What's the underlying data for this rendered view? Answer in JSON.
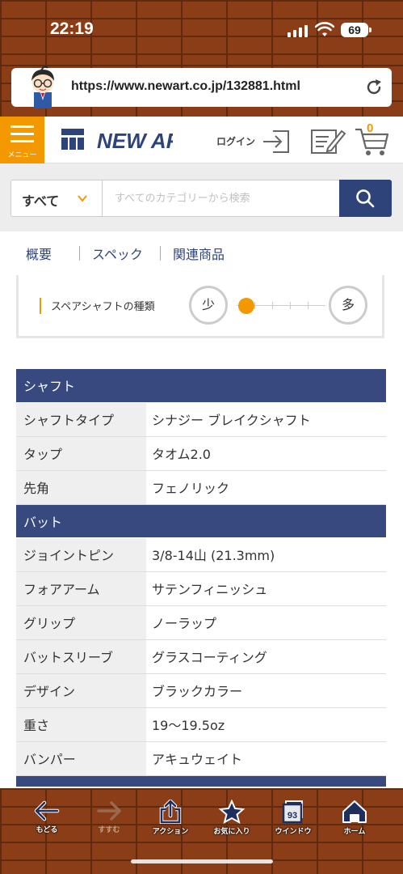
{
  "status": {
    "time": "22:19",
    "battery": "69"
  },
  "browser": {
    "url": "https://www.newart.co.jp/132881.html"
  },
  "header": {
    "menu_label": "メニュー",
    "logo_text": "NEW ART",
    "login_label": "ログイン",
    "cart_count": "0"
  },
  "search": {
    "category": "すべて",
    "placeholder": "すべてのカテゴリーから検索"
  },
  "tabs": [
    {
      "label": "概要"
    },
    {
      "label": "スペック"
    },
    {
      "label": "関連商品"
    }
  ],
  "spare_shaft": {
    "label": "スペアシャフトの種類",
    "min_label": "少",
    "max_label": "多",
    "level": 0
  },
  "spec": {
    "sections": [
      {
        "title": "シャフト",
        "rows": [
          {
            "key": "シャフトタイプ",
            "value": "シナジー ブレイクシャフト"
          },
          {
            "key": "タップ",
            "value": "タオム2.0"
          },
          {
            "key": "先角",
            "value": "フェノリック"
          }
        ]
      },
      {
        "title": "バット",
        "rows": [
          {
            "key": "ジョイントピン",
            "value": "3/8-14山 (21.3mm)"
          },
          {
            "key": "フォアアーム",
            "value": "サテンフィニッシュ"
          },
          {
            "key": "グリップ",
            "value": "ノーラップ"
          },
          {
            "key": "バットスリーブ",
            "value": "グラスコーティング"
          },
          {
            "key": "デザイン",
            "value": "ブラックカラー"
          },
          {
            "key": "重さ",
            "value": "19〜19.5oz"
          },
          {
            "key": "バンパー",
            "value": "アキュウェイト"
          }
        ]
      }
    ]
  },
  "toolbar": {
    "back": "もどる",
    "forward": "すすむ",
    "action": "アクション",
    "favorites": "お気に入り",
    "window": "ウインドウ",
    "window_count": "93",
    "home": "ホーム"
  },
  "colors": {
    "accent": "#f39800",
    "navy": "#2e4379",
    "table_header": "#37497f",
    "brick": "#8a3d17"
  }
}
